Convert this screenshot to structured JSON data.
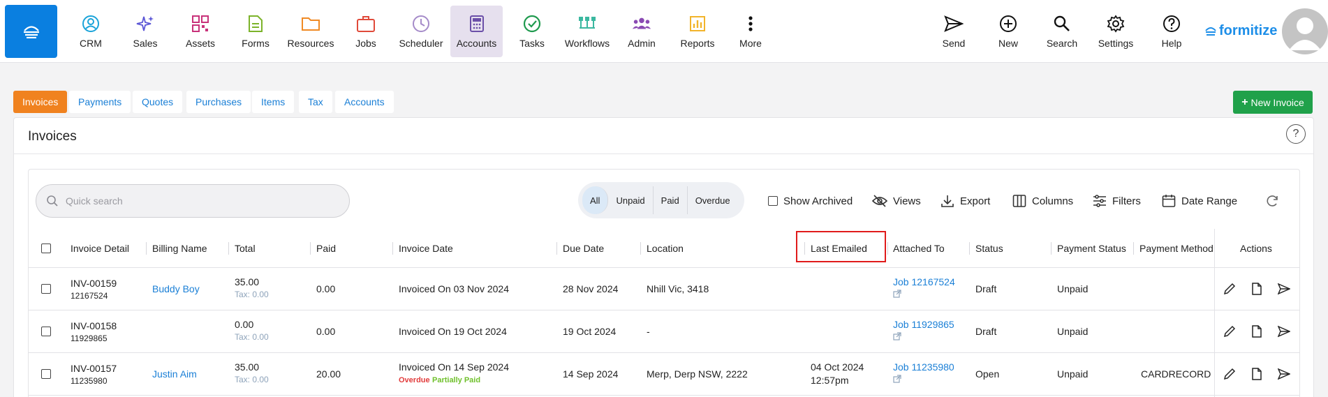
{
  "nav": {
    "items": [
      {
        "label": "CRM",
        "icon": "user-circle-icon"
      },
      {
        "label": "Sales",
        "icon": "sparkle-icon"
      },
      {
        "label": "Assets",
        "icon": "qr-code-icon"
      },
      {
        "label": "Forms",
        "icon": "document-icon"
      },
      {
        "label": "Resources",
        "icon": "folder-icon"
      },
      {
        "label": "Jobs",
        "icon": "briefcase-icon"
      },
      {
        "label": "Scheduler",
        "icon": "clock-icon"
      },
      {
        "label": "Accounts",
        "icon": "calculator-icon"
      },
      {
        "label": "Tasks",
        "icon": "check-circle-icon"
      },
      {
        "label": "Workflows",
        "icon": "workflow-icon"
      },
      {
        "label": "Admin",
        "icon": "group-icon"
      },
      {
        "label": "Reports",
        "icon": "chart-icon"
      },
      {
        "label": "More",
        "icon": "more-vertical-icon"
      }
    ],
    "right": [
      {
        "label": "Send",
        "icon": "send-icon"
      },
      {
        "label": "New",
        "icon": "plus-circle-icon"
      },
      {
        "label": "Search",
        "icon": "search-icon"
      },
      {
        "label": "Settings",
        "icon": "gear-icon"
      },
      {
        "label": "Help",
        "icon": "help-icon"
      }
    ],
    "brand": "formitize",
    "active": "Accounts"
  },
  "tabs": [
    "Invoices",
    "Payments",
    "Quotes",
    "Purchases",
    "Items",
    "Tax",
    "Accounts"
  ],
  "new_invoice_label": "New Invoice",
  "card_title": "Invoices",
  "search": {
    "placeholder": "Quick search"
  },
  "filters": [
    "All",
    "Unpaid",
    "Paid",
    "Overdue"
  ],
  "toolbar": {
    "show_archived": "Show Archived",
    "views": "Views",
    "export": "Export",
    "columns": "Columns",
    "filters": "Filters",
    "date_range": "Date Range"
  },
  "columns": [
    "Invoice Detail",
    "Billing Name",
    "Total",
    "Paid",
    "Invoice Date",
    "Due Date",
    "Location",
    "Last Emailed",
    "Attached To",
    "Status",
    "Payment Status",
    "Payment Method",
    "Actions"
  ],
  "rows": [
    {
      "invoice": "INV-00159",
      "ref": "12167524",
      "billing": "Buddy Boy",
      "total": "35.00",
      "tax": "Tax: 0.00",
      "paid": "0.00",
      "invoice_date": "Invoiced On 03 Nov 2024",
      "overdue": "",
      "partially": "",
      "due": "28 Nov 2024",
      "location": "Nhill Vic, 3418",
      "emailed_date": "",
      "emailed_time": "",
      "attached": "Job 12167524",
      "status": "Draft",
      "payment_status": "Unpaid",
      "method": ""
    },
    {
      "invoice": "INV-00158",
      "ref": "11929865",
      "billing": "",
      "total": "0.00",
      "tax": "Tax: 0.00",
      "paid": "0.00",
      "invoice_date": "Invoiced On 19 Oct 2024",
      "overdue": "",
      "partially": "",
      "due": "19 Oct 2024",
      "location": "-",
      "emailed_date": "",
      "emailed_time": "",
      "attached": "Job 11929865",
      "status": "Draft",
      "payment_status": "Unpaid",
      "method": ""
    },
    {
      "invoice": "INV-00157",
      "ref": "11235980",
      "billing": "Justin Aim",
      "total": "35.00",
      "tax": "Tax: 0.00",
      "paid": "20.00",
      "invoice_date": "Invoiced On 14 Sep 2024",
      "overdue": "Overdue",
      "partially": "Partially Paid",
      "due": "14 Sep 2024",
      "location": "Merp, Derp NSW, 2222",
      "emailed_date": "04 Oct 2024",
      "emailed_time": "12:57pm",
      "attached": "Job 11235980",
      "status": "Open",
      "payment_status": "Unpaid",
      "method": "CARDRECORD"
    }
  ],
  "colors": {
    "brand_blue": "#0a7fe0",
    "active_tab": "#f0821f",
    "new_btn": "#20a14a",
    "link": "#1a7fd6",
    "highlight": "#e01b1b"
  }
}
